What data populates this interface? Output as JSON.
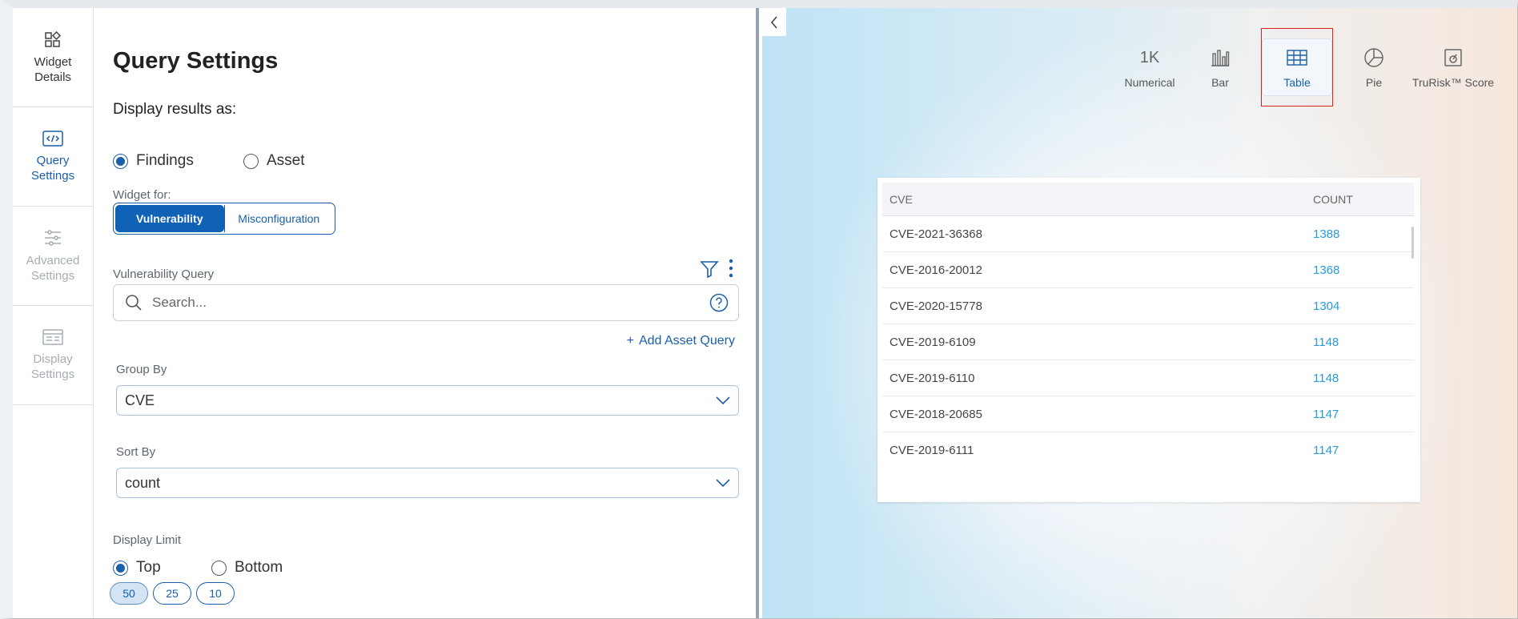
{
  "rail": {
    "items": [
      {
        "label": "Widget Details"
      },
      {
        "label": "Query Settings"
      },
      {
        "label": "Advanced Settings"
      },
      {
        "label": "Display Settings"
      }
    ]
  },
  "panel": {
    "title": "Query Settings",
    "display_as_label": "Display results as:",
    "display_as_options": [
      "Findings",
      "Asset"
    ],
    "display_as_selected": "Findings",
    "widget_for_label": "Widget for:",
    "widget_for_options": [
      "Vulnerability",
      "Misconfiguration"
    ],
    "widget_for_selected": "Vulnerability",
    "query_label": "Vulnerability Query",
    "search_placeholder": "Search...",
    "add_asset_query": "Add Asset Query",
    "group_by_label": "Group By",
    "group_by_value": "CVE",
    "sort_by_label": "Sort By",
    "sort_by_value": "count",
    "display_limit_label": "Display Limit",
    "display_limit_options": [
      "Top",
      "Bottom"
    ],
    "display_limit_selected": "Top",
    "limit_chips": [
      "50",
      "25",
      "10"
    ],
    "limit_selected": "50"
  },
  "preview": {
    "viz_types": [
      {
        "label": "Numerical",
        "icon": "1K"
      },
      {
        "label": "Bar",
        "icon": "bar-chart-icon"
      },
      {
        "label": "Table",
        "icon": "table-icon"
      },
      {
        "label": "Pie",
        "icon": "pie-chart-icon"
      },
      {
        "label": "TruRisk™ Score",
        "icon": "trurisk-icon"
      }
    ],
    "selected_viz": "Table",
    "selected_outline_color": "#e02020",
    "table": {
      "headers": [
        "CVE",
        "COUNT"
      ],
      "rows": [
        [
          "CVE-2021-36368",
          "1388"
        ],
        [
          "CVE-2016-20012",
          "1368"
        ],
        [
          "CVE-2020-15778",
          "1304"
        ],
        [
          "CVE-2019-6109",
          "1148"
        ],
        [
          "CVE-2019-6110",
          "1148"
        ],
        [
          "CVE-2018-20685",
          "1147"
        ],
        [
          "CVE-2019-6111",
          "1147"
        ]
      ]
    }
  },
  "colors": {
    "accent": "#1a5fa8",
    "link_count": "#2a9ad8"
  }
}
